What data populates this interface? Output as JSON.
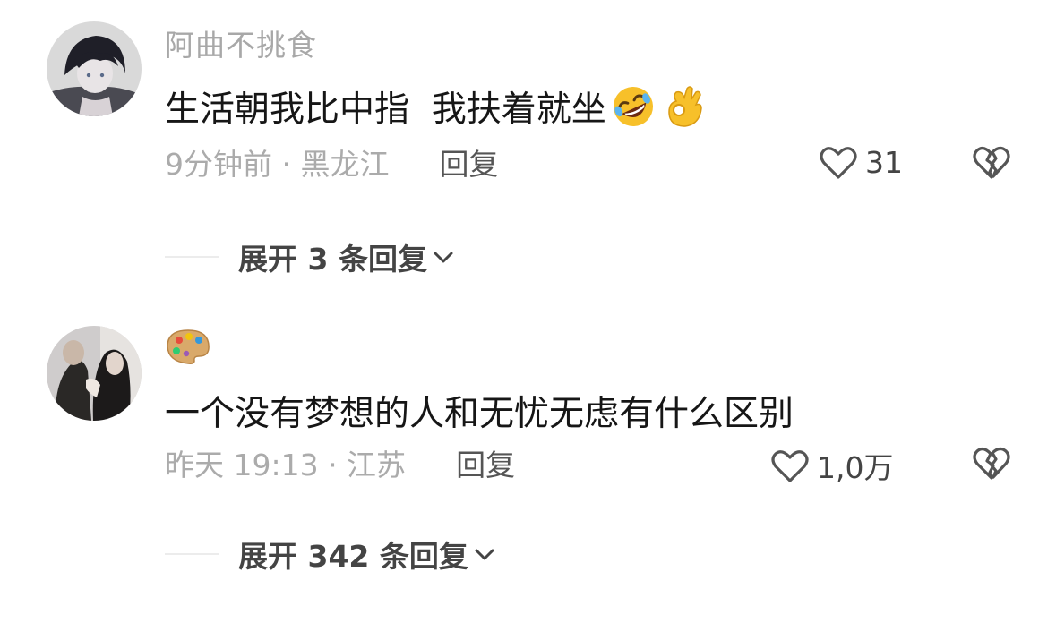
{
  "comments": [
    {
      "username": "阿曲不挑食",
      "text": "生活朝我比中指  我扶着就坐",
      "emojis": [
        "rolling-on-floor-laughing-emoji",
        "ok-hand-emoji"
      ],
      "time_location": "9分钟前 · 黑龙江",
      "reply_label": "回复",
      "like_count": "31",
      "expand_label": "展开 3 条回复"
    },
    {
      "username_emoji": "artist-palette-emoji",
      "text": "一个没有梦想的人和无忧无虑有什么区别",
      "time_location": "昨天 19:13 · 江苏",
      "reply_label": "回复",
      "like_count": "1,0万",
      "expand_label": "展开 342 条回复"
    }
  ],
  "icons": {
    "like": "heart-outline-icon",
    "dislike": "broken-heart-icon",
    "expand": "chevron-down-icon"
  },
  "colors": {
    "text_primary": "#161616",
    "text_secondary": "#a8a8a8",
    "icon_gray": "#555555",
    "emoji_yellow": "#f7c02a"
  }
}
